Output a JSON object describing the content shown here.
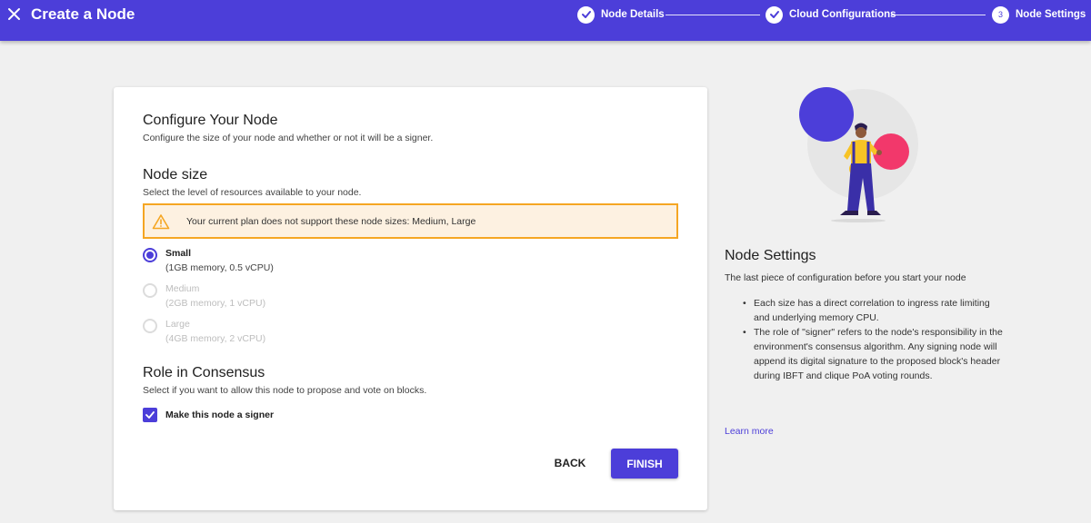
{
  "header": {
    "title": "Create a Node",
    "steps": [
      {
        "label": "Node Details",
        "state": "done"
      },
      {
        "label": "Cloud Configurations",
        "state": "done"
      },
      {
        "label": "Node Settings",
        "number": "3",
        "state": "active"
      }
    ]
  },
  "form": {
    "configure_title": "Configure Your Node",
    "configure_sub": "Configure the size of your node and whether or not it will be a signer.",
    "size_title": "Node size",
    "size_sub": "Select the level of resources available to your node.",
    "warning": "Your current plan does not support these node sizes: Medium, Large",
    "sizes": [
      {
        "label": "Small",
        "desc": "(1GB memory, 0.5 vCPU)",
        "selected": true,
        "disabled": false
      },
      {
        "label": "Medium",
        "desc": "(2GB memory, 1 vCPU)",
        "selected": false,
        "disabled": true
      },
      {
        "label": "Large",
        "desc": "(4GB memory, 2 vCPU)",
        "selected": false,
        "disabled": true
      }
    ],
    "role_title": "Role in Consensus",
    "role_sub": "Select if you want to allow this node to propose and vote on blocks.",
    "signer_label": "Make this node a signer",
    "signer_checked": true,
    "back_label": "BACK",
    "finish_label": "FINISH"
  },
  "sidebar": {
    "title": "Node Settings",
    "subtitle": "The last piece of configuration before you start your node",
    "bullets": [
      "Each size has a direct correlation to ingress rate limiting and underlying memory CPU.",
      "The role of \"signer\" refers to the node's responsibility in the environment's consensus algorithm. Any signing node will append its digital signature to the proposed block's header during IBFT and clique PoA voting rounds."
    ],
    "learn_more": "Learn more"
  },
  "colors": {
    "primary": "#4c3ed9",
    "warning_border": "#f5a623",
    "warning_bg": "#fdf1e1",
    "accent_pink": "#f2386b",
    "accent_yellow": "#f7c325"
  }
}
